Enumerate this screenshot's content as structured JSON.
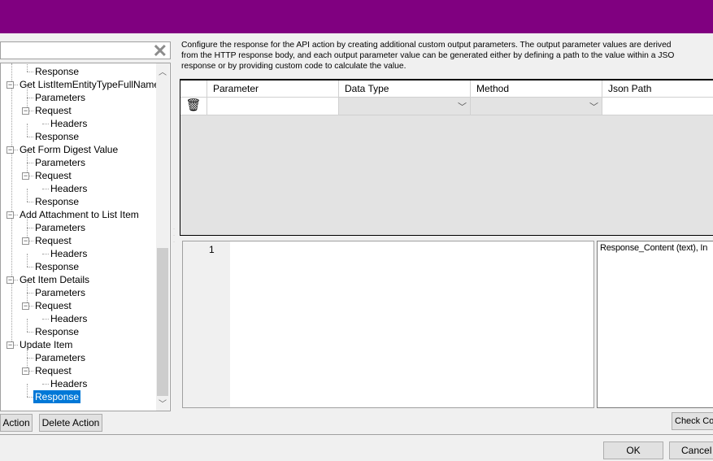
{
  "search": {
    "clear_icon": "close-icon"
  },
  "tree": [
    {
      "label": "Response",
      "level": 2
    },
    {
      "label": "Get ListItemEntityTypeFullName",
      "level": 1
    },
    {
      "label": "Parameters",
      "level": 2
    },
    {
      "label": "Request",
      "level": 2
    },
    {
      "label": "Headers",
      "level": 3
    },
    {
      "label": "Response",
      "level": 2
    },
    {
      "label": "Get Form Digest Value",
      "level": 1
    },
    {
      "label": "Parameters",
      "level": 2
    },
    {
      "label": "Request",
      "level": 2
    },
    {
      "label": "Headers",
      "level": 3
    },
    {
      "label": "Response",
      "level": 2
    },
    {
      "label": "Add Attachment to List Item",
      "level": 1
    },
    {
      "label": "Parameters",
      "level": 2
    },
    {
      "label": "Request",
      "level": 2
    },
    {
      "label": "Headers",
      "level": 3
    },
    {
      "label": "Response",
      "level": 2
    },
    {
      "label": "Get Item Details",
      "level": 1
    },
    {
      "label": "Parameters",
      "level": 2
    },
    {
      "label": "Request",
      "level": 2
    },
    {
      "label": "Headers",
      "level": 3
    },
    {
      "label": "Response",
      "level": 2
    },
    {
      "label": "Update Item",
      "level": 1
    },
    {
      "label": "Parameters",
      "level": 2
    },
    {
      "label": "Request",
      "level": 2
    },
    {
      "label": "Headers",
      "level": 3
    },
    {
      "label": "Response",
      "level": 2,
      "selected": true
    }
  ],
  "buttons": {
    "add_action": "Action",
    "delete_action": "Delete Action",
    "check_code": "Check Co",
    "ok": "OK",
    "cancel": "Cancel"
  },
  "description": [
    "Configure the response for the API action by creating additional custom output parameters. The output parameter values are derived",
    "from the HTTP response body, and each output parameter value can be generated either by defining a path to the value within a JSO",
    "response or by providing custom code to calculate the value."
  ],
  "grid": {
    "columns": [
      "Parameter",
      "Data Type",
      "Method",
      "Json Path"
    ],
    "row": {
      "parameter": "",
      "data_type": "",
      "method": "",
      "json_path": ""
    }
  },
  "editor": {
    "line_number": "1"
  },
  "variables": "Response_Content (text), In",
  "colors": {
    "titlebar": "#800080",
    "selection": "#0078d7"
  }
}
